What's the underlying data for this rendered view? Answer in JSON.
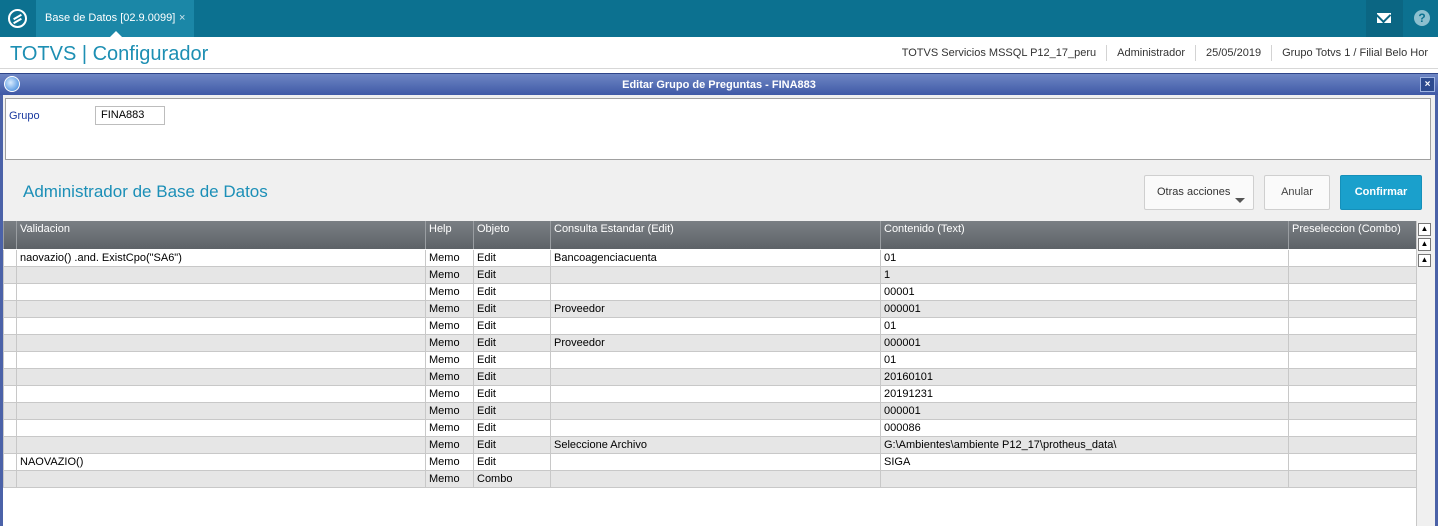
{
  "app": {
    "tab_title": "Base de Datos [02.9.0099]",
    "tab_close": "×",
    "brand": "TOTVS | Configurador"
  },
  "header_info": {
    "environment": "TOTVS Servicios MSSQL P12_17_peru",
    "user": "Administrador",
    "date": "25/05/2019",
    "branch": "Grupo Totvs 1 / Filial Belo Hor"
  },
  "dialog": {
    "title": "Editar Grupo de Preguntas - FINA883",
    "close_label": "×",
    "group_label": "Grupo",
    "group_value": "FINA883",
    "section_title": "Administrador de Base de Datos",
    "buttons": {
      "otras": "Otras acciones",
      "anular": "Anular",
      "confirmar": "Confirmar"
    }
  },
  "grid": {
    "columns": [
      "Validacion",
      "Help",
      "Objeto",
      "Consulta Estandar (Edit)",
      "Contenido (Text)",
      "Preseleccion (Combo)"
    ],
    "rows": [
      [
        "naovazio() .and. ExistCpo(\"SA6\")",
        "Memo",
        "Edit",
        "Bancoagenciacuenta",
        "01",
        ""
      ],
      [
        "",
        "Memo",
        "Edit",
        "",
        "1",
        ""
      ],
      [
        "",
        "Memo",
        "Edit",
        "",
        "00001",
        ""
      ],
      [
        "",
        "Memo",
        "Edit",
        "Proveedor",
        "000001",
        ""
      ],
      [
        "",
        "Memo",
        "Edit",
        "",
        "01",
        ""
      ],
      [
        "",
        "Memo",
        "Edit",
        "Proveedor",
        "000001",
        ""
      ],
      [
        "",
        "Memo",
        "Edit",
        "",
        "01",
        ""
      ],
      [
        "",
        "Memo",
        "Edit",
        "",
        "20160101",
        ""
      ],
      [
        "",
        "Memo",
        "Edit",
        "",
        "20191231",
        ""
      ],
      [
        "",
        "Memo",
        "Edit",
        "",
        "000001",
        ""
      ],
      [
        "",
        "Memo",
        "Edit",
        "",
        "000086",
        ""
      ],
      [
        "",
        "Memo",
        "Edit",
        "Seleccione Archivo",
        "G:\\Ambientes\\ambiente P12_17\\protheus_data\\",
        ""
      ],
      [
        "NAOVAZIO()",
        "Memo",
        "Edit",
        "",
        "SIGA",
        ""
      ],
      [
        "",
        "Memo",
        "Combo",
        "",
        "",
        ""
      ]
    ]
  }
}
